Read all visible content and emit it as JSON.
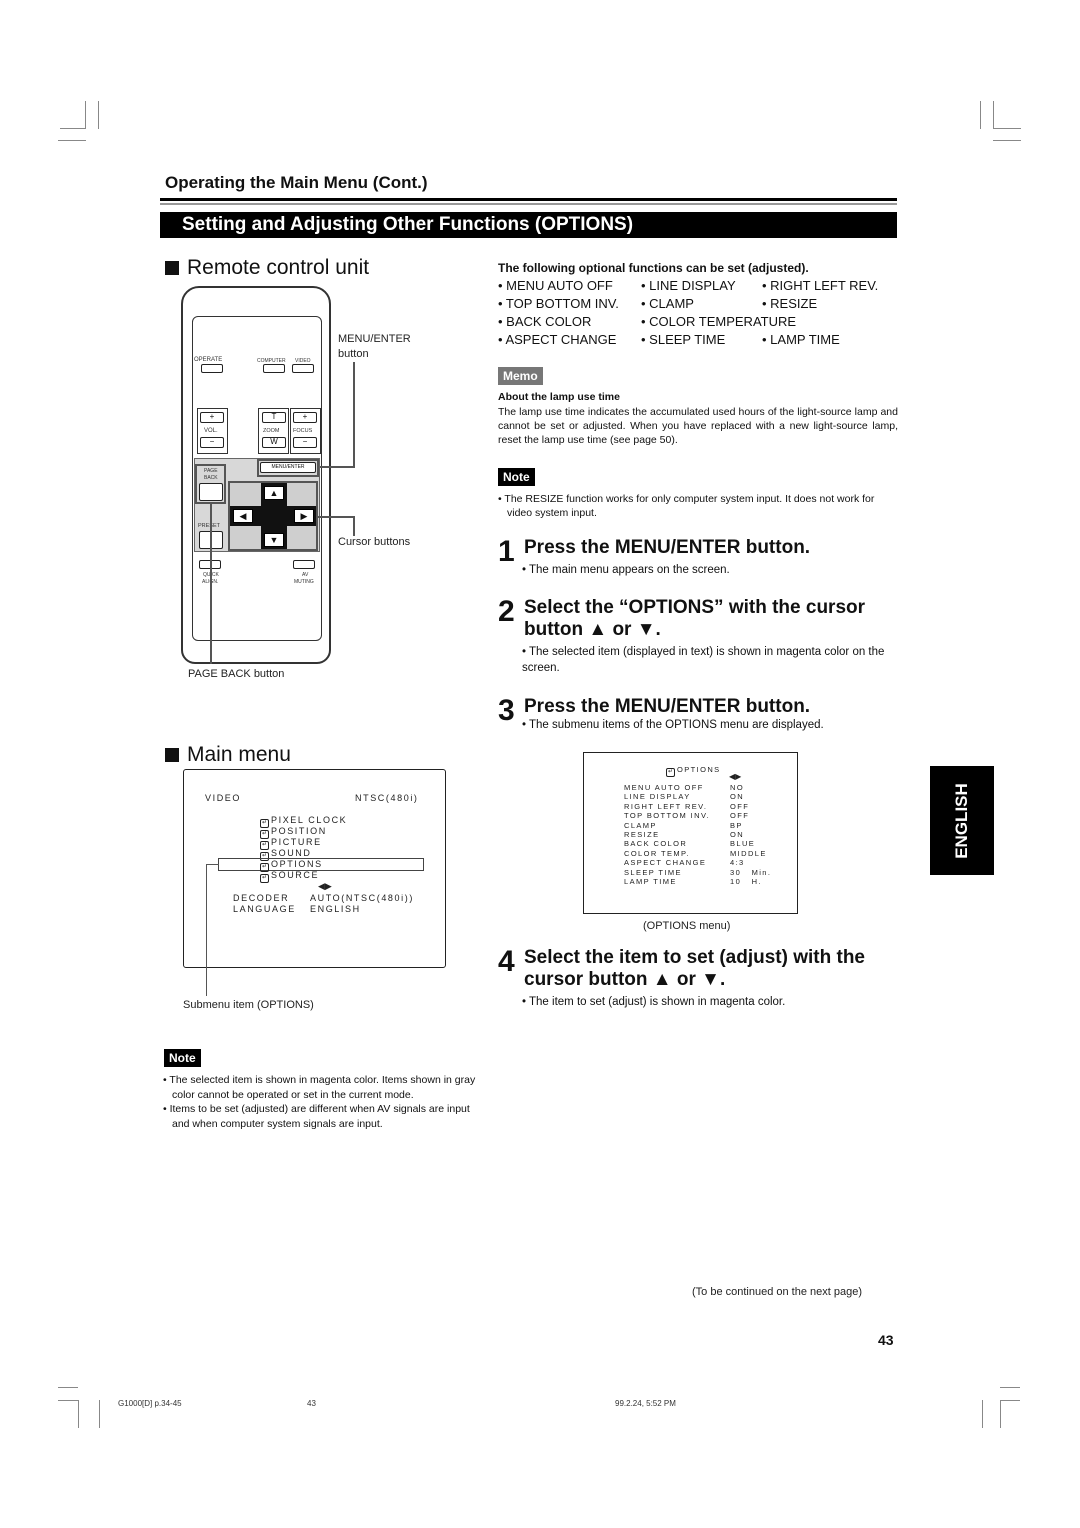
{
  "header": {
    "section_title": "Operating the Main Menu (Cont.)",
    "title_bar": "Setting and Adjusting Other Functions (OPTIONS)"
  },
  "remote": {
    "heading": "Remote control unit",
    "labels": {
      "operate": "OPERATE",
      "computer": "COMPUTER",
      "video": "VIDEO",
      "vol": "VOL.",
      "zoom": "ZOOM",
      "focus": "FOCUS",
      "plus": "+",
      "minus": "−",
      "t": "T",
      "w": "W",
      "menu_enter": "MENU/ENTER",
      "page_back": "PAGE BACK",
      "page": "PAGE",
      "back": "BACK",
      "preset": "PRESET",
      "quick": "QUICK",
      "align": "ALIGN.",
      "av": "AV",
      "muting": "MUTING",
      "up": "▲",
      "down": "▼",
      "left": "◀",
      "right": "▶"
    },
    "callouts": {
      "menu_enter_1": "MENU/ENTER",
      "menu_enter_2": "button",
      "cursor": "Cursor buttons",
      "page_back": "PAGE BACK button"
    }
  },
  "options_intro": {
    "heading": "The following optional functions can be set (adjusted).",
    "items": [
      "• MENU AUTO OFF",
      "• LINE DISPLAY",
      "• RIGHT LEFT REV.",
      "• TOP BOTTOM INV.",
      "• CLAMP",
      "• RESIZE",
      "• BACK COLOR",
      "• COLOR TEMPERATURE",
      "",
      "• ASPECT CHANGE",
      "• SLEEP TIME",
      "• LAMP TIME"
    ]
  },
  "memo": {
    "badge": "Memo",
    "title": "About the lamp use time",
    "body": "The lamp use time indicates the accumulated used hours of the light-source lamp and cannot be set or adjusted. When you have replaced with a new light-source lamp, reset the lamp use time (see page 50)."
  },
  "note_right": {
    "badge": "Note",
    "items": [
      "• The RESIZE function works for only computer system input. It does not work for video system input."
    ]
  },
  "steps": [
    {
      "num": "1",
      "title": "Press the MENU/ENTER button.",
      "desc": "• The main menu appears on the screen."
    },
    {
      "num": "2",
      "title": "Select the “OPTIONS” with the cursor button ▲ or ▼.",
      "desc": "• The selected item (displayed in text) is shown in magenta color on the screen."
    },
    {
      "num": "3",
      "title": "Press the MENU/ENTER button.",
      "desc": "• The submenu items of the OPTIONS menu are displayed."
    },
    {
      "num": "4",
      "title": "Select the item to set (adjust) with the cursor button ▲ or ▼.",
      "desc": "• The item to set (adjust) is shown in magenta color."
    }
  ],
  "main_menu": {
    "heading": "Main menu",
    "source": "VIDEO",
    "signal": "NTSC(480i)",
    "items": [
      "PIXEL CLOCK",
      "POSITION",
      "PICTURE",
      "SOUND",
      "OPTIONS",
      "SOURCE"
    ],
    "selected_index": 4,
    "arrows": "◀▶",
    "settings": [
      {
        "label": "DECODER",
        "value": "AUTO(NTSC(480i))"
      },
      {
        "label": "LANGUAGE",
        "value": "ENGLISH"
      }
    ],
    "callout": "Submenu item (OPTIONS)"
  },
  "options_menu": {
    "title": "OPTIONS",
    "arrows": "◀▶",
    "rows": [
      {
        "label": "MENU AUTO OFF",
        "value": "NO"
      },
      {
        "label": "LINE DISPLAY",
        "value": "ON"
      },
      {
        "label": "RIGHT LEFT REV.",
        "value": "OFF"
      },
      {
        "label": "TOP BOTTOM INV.",
        "value": "OFF"
      },
      {
        "label": "CLAMP",
        "value": "BP"
      },
      {
        "label": "RESIZE",
        "value": "ON"
      },
      {
        "label": "BACK COLOR",
        "value": "BLUE"
      },
      {
        "label": "COLOR TEMP.",
        "value": "MIDDLE"
      },
      {
        "label": "ASPECT CHANGE",
        "value": "4:3"
      },
      {
        "label": "SLEEP TIME",
        "value": "30   Min."
      },
      {
        "label": "LAMP TIME",
        "value": "10   H."
      }
    ],
    "caption": "(OPTIONS menu)"
  },
  "note_left": {
    "badge": "Note",
    "items": [
      "• The selected item is shown in magenta color. Items shown in gray color cannot be operated or set in the current mode.",
      "• Items to be set (adjusted) are different when AV signals are input and when computer system signals are input."
    ]
  },
  "language_tab": "ENGLISH",
  "continued": "(To be continued on the next page)",
  "page_number": "43",
  "footer": {
    "file": "G1000[D]  p.34-45",
    "page": "43",
    "date": "99.2.24, 5:52 PM"
  }
}
